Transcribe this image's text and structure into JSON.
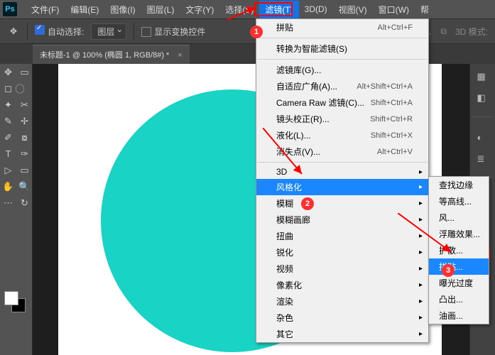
{
  "app": {
    "logo": "Ps"
  },
  "menubar": [
    "文件(F)",
    "编辑(E)",
    "图像(I)",
    "图层(L)",
    "文字(Y)",
    "选择(S)",
    "滤镜(T)",
    "3D(D)",
    "视图(V)",
    "窗口(W)",
    "帮"
  ],
  "menubar_active_index": 6,
  "options": {
    "auto_select": "自动选择:",
    "layer_select": "图层",
    "transform_controls": "显示变换控件",
    "mode_3d": "3D 模式:"
  },
  "doc_tab": "未标题-1 @ 100% (椭圆 1, RGB/8#) *",
  "filter_menu": {
    "last": {
      "label": "拼贴",
      "shortcut": "Alt+Ctrl+F"
    },
    "smart": "转换为智能滤镜(S)",
    "items": [
      {
        "label": "滤镜库(G)...",
        "sc": ""
      },
      {
        "label": "自适应广角(A)...",
        "sc": "Alt+Shift+Ctrl+A"
      },
      {
        "label": "Camera Raw 滤镜(C)...",
        "sc": "Shift+Ctrl+A"
      },
      {
        "label": "镜头校正(R)...",
        "sc": "Shift+Ctrl+R"
      },
      {
        "label": "液化(L)...",
        "sc": "Shift+Ctrl+X"
      },
      {
        "label": "消失点(V)...",
        "sc": "Alt+Ctrl+V"
      }
    ],
    "groups": [
      "3D",
      "风格化",
      "模糊",
      "模糊画廊",
      "扭曲",
      "锐化",
      "视频",
      "像素化",
      "渲染",
      "杂色",
      "其它"
    ],
    "group_selected_index": 1
  },
  "stylize_submenu": [
    "查找边缘",
    "等高线...",
    "风...",
    "浮雕效果...",
    "扩散...",
    "拼贴...",
    "曝光过度",
    "凸出...",
    "油画..."
  ],
  "stylize_selected_index": 5,
  "annotations": {
    "n1": "1",
    "n2": "2",
    "n3": "3"
  }
}
